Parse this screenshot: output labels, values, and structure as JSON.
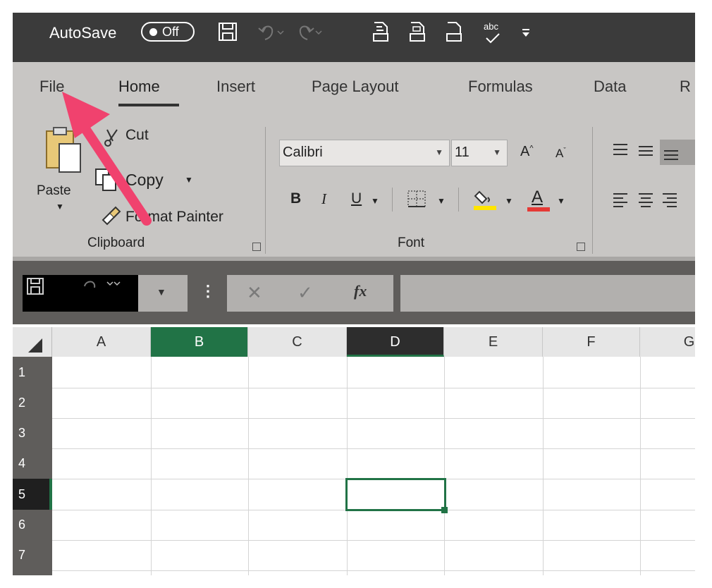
{
  "titlebar": {
    "autosave_label": "AutoSave",
    "toggle_state": "Off",
    "qat_icons": [
      "save-icon",
      "undo-icon",
      "redo-icon",
      "print-preview-icon",
      "quick-print-icon",
      "print-icon",
      "spelling-icon",
      "customize-qat-icon"
    ],
    "spelling_label": "abc"
  },
  "tabs": [
    "File",
    "Home",
    "Insert",
    "Page Layout",
    "Formulas",
    "Data",
    "R"
  ],
  "active_tab": "Home",
  "clipboard": {
    "paste_label": "Paste",
    "cut_label": "Cut",
    "copy_label": "Copy",
    "format_painter_label": "Format Painter",
    "group_label": "Clipboard"
  },
  "font": {
    "font_name": "Calibri",
    "font_size": "11",
    "bold_label": "B",
    "italic_label": "I",
    "underline_label": "U",
    "font_color_label": "A",
    "group_label": "Font",
    "highlight_color": "#ffe500",
    "font_color": "#e53935"
  },
  "formula_bar": {
    "fx_label": "fx",
    "value": ""
  },
  "grid": {
    "columns": [
      "A",
      "B",
      "C",
      "D",
      "E",
      "F",
      "G"
    ],
    "rows": [
      "1",
      "2",
      "3",
      "4",
      "5",
      "6",
      "7"
    ],
    "selected_column": "D",
    "active_cell": "D5"
  },
  "annotation": {
    "arrow_color": "#f0426e",
    "target": "File"
  },
  "colors": {
    "accent": "#217346",
    "ribbon": "#c8c6c4",
    "titlebar": "#3b3b3b"
  }
}
